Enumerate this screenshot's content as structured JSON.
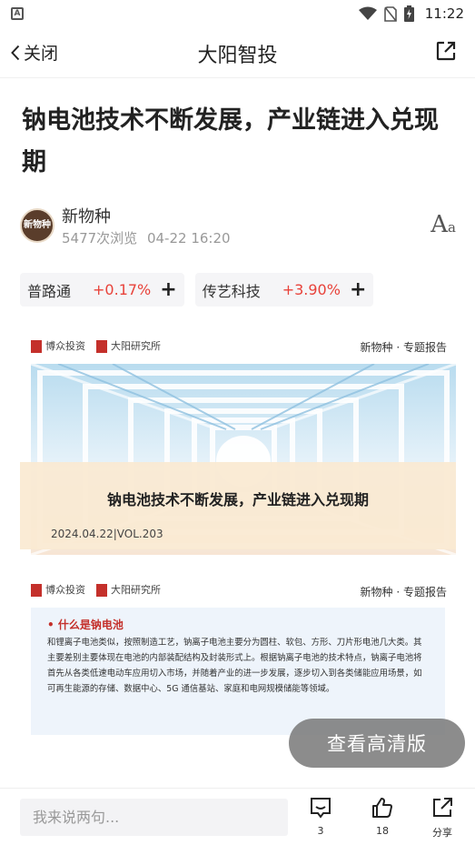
{
  "status_bar": {
    "time": "11:22",
    "app_icon": "A"
  },
  "navbar": {
    "back_label": "关闭",
    "title": "大阳智投"
  },
  "article": {
    "title": "钠电池技术不断发展，产业链进入兑现期",
    "author": "新物种",
    "avatar_text": "新物种",
    "views": "5477次浏览",
    "date": "04-22 16:20",
    "font_toggle": {
      "large": "A",
      "small": "a"
    }
  },
  "stocks": [
    {
      "name": "普路通",
      "change": "+0.17%"
    },
    {
      "name": "传艺科技",
      "change": "+3.90%"
    }
  ],
  "report": {
    "logo_left": "博众投资",
    "logo_right": "大阳研究所",
    "tag": "新物种 · 专题报告",
    "cover_title": "钠电池技术不断发展，产业链进入兑现期",
    "cover_date": "2024.04.22|VOL.203",
    "section_heading": "• 什么是钠电池",
    "section_body": "和锂离子电池类似，按照制造工艺，钠离子电池主要分为圆柱、软包、方形、刀片形电池几大类。其主要差别主要体现在电池的内部装配结构及封装形式上。根据钠离子电池的技术特点，钠离子电池将首先从各类低速电动车应用切入市场，并随着产业的进一步发展，逐步切入到各类储能应用场景，如可再生能源的存储、数据中心、5G 通信基站、家庭和电网规模储能等领域。"
  },
  "hd_button": "查看高清版",
  "bottom_bar": {
    "comment_placeholder": "我来说两句...",
    "comments_count": "3",
    "likes_count": "18",
    "share_label": "分享"
  },
  "colors": {
    "up": "#e8423a",
    "accent_red": "#c4302b"
  }
}
